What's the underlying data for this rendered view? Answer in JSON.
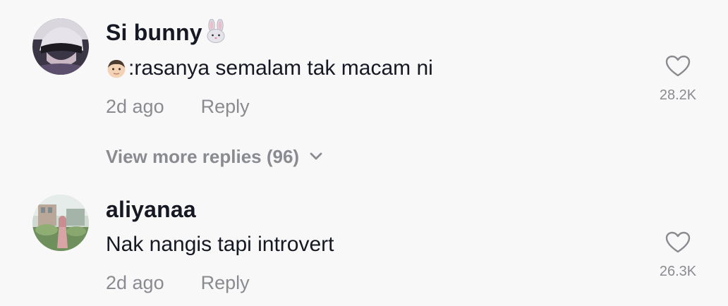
{
  "comments": [
    {
      "username": "Si bunny",
      "username_emoji": "rabbit-face",
      "text_emoji": "boy-face",
      "text": ":rasanya semalam tak macam ni",
      "time": "2d ago",
      "reply_label": "Reply",
      "likes": "28.2K"
    },
    {
      "username": "aliyanaa",
      "text": "Nak nangis tapi introvert",
      "time": "2d ago",
      "reply_label": "Reply",
      "likes": "26.3K"
    }
  ],
  "view_more": {
    "label": "View more replies (96)",
    "icon": "chevron-down-icon"
  },
  "colors": {
    "background": "#f8f8f8",
    "primary_text": "#161823",
    "secondary_text": "#8a8b91"
  }
}
